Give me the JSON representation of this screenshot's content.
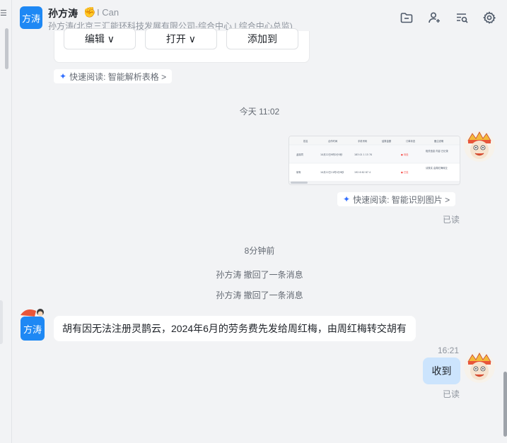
{
  "header": {
    "avatar_text": "方涛",
    "name": "孙方涛",
    "status_emoji": "✊",
    "signature": "I Can",
    "subtitle": "孙方涛(北京三汇能环科技发展有限公司-综合中心 | 综合中心总监)",
    "tools": [
      "folder-icon",
      "add-member-icon",
      "search-history-icon",
      "settings-icon"
    ]
  },
  "messages": {
    "prev_card": {
      "buttons": [
        "编辑 ∨",
        "打开 ∨",
        "添加到"
      ]
    },
    "quick_read_table": "快速阅读: 智能解析表格 >",
    "time_divider_1": "今天 11:02",
    "image_table": {
      "headers": [
        "姓名",
        "合作时间",
        "手机号码",
        "结算金额",
        "订单状态",
        "备注说明"
      ],
      "rows": [
        [
          "孟晓同",
          "10月22日9时0分5秒",
          "183 01 1 15 70",
          "",
          "● 待处",
          "相关信息 内容 已记录"
        ],
        [
          "胡有",
          "10月22日11时0分9秒",
          "192 6 62 87 4",
          "",
          "● 已处",
          "请核实 由周红梅转交"
        ]
      ]
    },
    "quick_read_image": "快速阅读: 智能识别图片 >",
    "read_1": "已读",
    "time_divider_2": "8分钟前",
    "recall_1": "孙方涛 撤回了一条消息",
    "recall_2": "孙方涛 撤回了一条消息",
    "sender_avatar_text": "方涛",
    "left_text": "胡有因无法注册灵鹊云，2024年6月的劳务费先发给周红梅，由周红梅转交胡有",
    "time_1621": "16:21",
    "right_text": "收到",
    "read_2": "已读"
  },
  "colors": {
    "accent": "#1e88f4",
    "bubble_self": "#cce4fd",
    "background": "#f2f3f5"
  }
}
